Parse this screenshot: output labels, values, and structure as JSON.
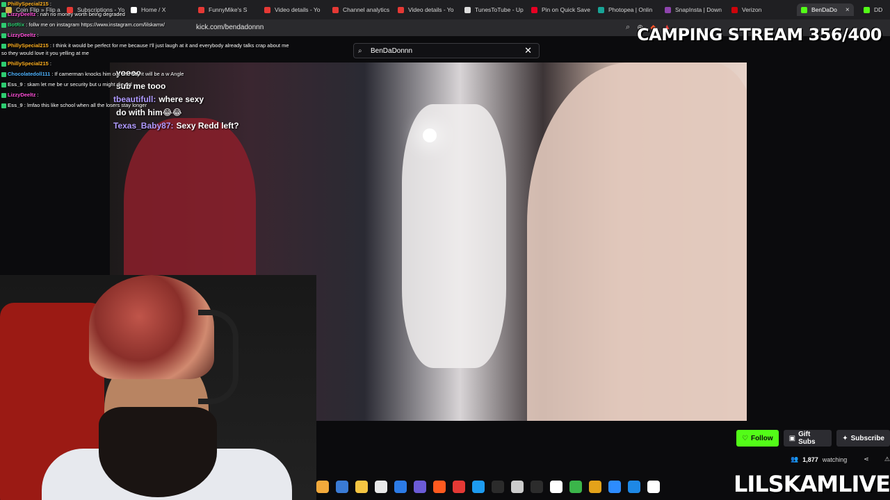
{
  "browser": {
    "tabs": [
      {
        "label": "Coin Flip » Flip a",
        "color": "#c8b14a"
      },
      {
        "label": "Subscriptions - Yo",
        "color": "#e53935"
      },
      {
        "label": "Home / X",
        "color": "#ffffff"
      },
      {
        "label": "FunnyMike's S",
        "color": "#e53935"
      },
      {
        "label": "Video details - Yo",
        "color": "#e53935"
      },
      {
        "label": "Channel analytics",
        "color": "#e53935"
      },
      {
        "label": "Video details - Yo",
        "color": "#e53935"
      },
      {
        "label": "TunesToTube - Up",
        "color": "#dddddd"
      },
      {
        "label": "Pin on Quick Save",
        "color": "#e60023"
      },
      {
        "label": "Photopea | Onlin",
        "color": "#18a497"
      },
      {
        "label": "SnapInsta | Down",
        "color": "#8e44ad"
      },
      {
        "label": "Verizon",
        "color": "#cd040b"
      },
      {
        "label": "BenDaDo",
        "color": "#53fc18",
        "active": true
      },
      {
        "label": "DD",
        "color": "#53fc18"
      }
    ],
    "url": "kick.com/bendadonnn"
  },
  "search": {
    "value": "BenDaDonnn"
  },
  "overlay": {
    "camping_title": "CAMPING STREAM 356/400",
    "brand": "LILSKAMLIVE"
  },
  "chat": [
    {
      "user": "PhillySpecial215",
      "text": ":"
    },
    {
      "user": "LizzyDeeltz",
      "text": ": nah no money worth being degraded"
    },
    {
      "user": "BotRix",
      "text": ": follw me on instagram https://www.instagram.com/lilskamx/"
    },
    {
      "user": "LizzyDeeltz",
      "text": ":"
    },
    {
      "user": "PhillySpecial215",
      "text": ": I think it would be perfect for me because I'll just laugh at it and everybody already talks crap about me so they would love it you yelling at me"
    },
    {
      "user": "PhillySpecial215",
      "text": ":"
    },
    {
      "user": "Chocolatedoll111",
      "text": ": If camerman knocks him out one day it will be a w Angle"
    },
    {
      "user": "Ess_9",
      "text": ": skam let me be ur security but u might die ngl"
    },
    {
      "user": "LizzyDeeltz",
      "text": ":"
    },
    {
      "user": "Ess_9",
      "text": ": lmfao this like school when all the losers stay longer"
    }
  ],
  "video_chat": [
    {
      "user": "",
      "text": "yoooo"
    },
    {
      "user": "",
      "text": "sub me tooo"
    },
    {
      "user": "tbeautifull:",
      "text": "where sexy"
    },
    {
      "user": "",
      "text": "do with him😂😂"
    },
    {
      "user": "Texas_Baby87:",
      "text": "Sexy Redd left?"
    }
  ],
  "actions": {
    "follow": "Follow",
    "gift": "Gift Subs",
    "subscribe": "Subscribe",
    "watching": "1,877",
    "watching_label": "watching"
  },
  "taskbar_colors": [
    "#f2a93b",
    "#3a7bd5",
    "#f5c542",
    "#e8e8e8",
    "#2c7be5",
    "#6b5bd6",
    "#ff5a1f",
    "#e53935",
    "#1d9bf0",
    "#2b2b2b",
    "#cccccc",
    "#2c2c2c",
    "#ffffff",
    "#3bb54a",
    "#e3a21a",
    "#2d8cff",
    "#1e88e5",
    "#ffffff"
  ]
}
